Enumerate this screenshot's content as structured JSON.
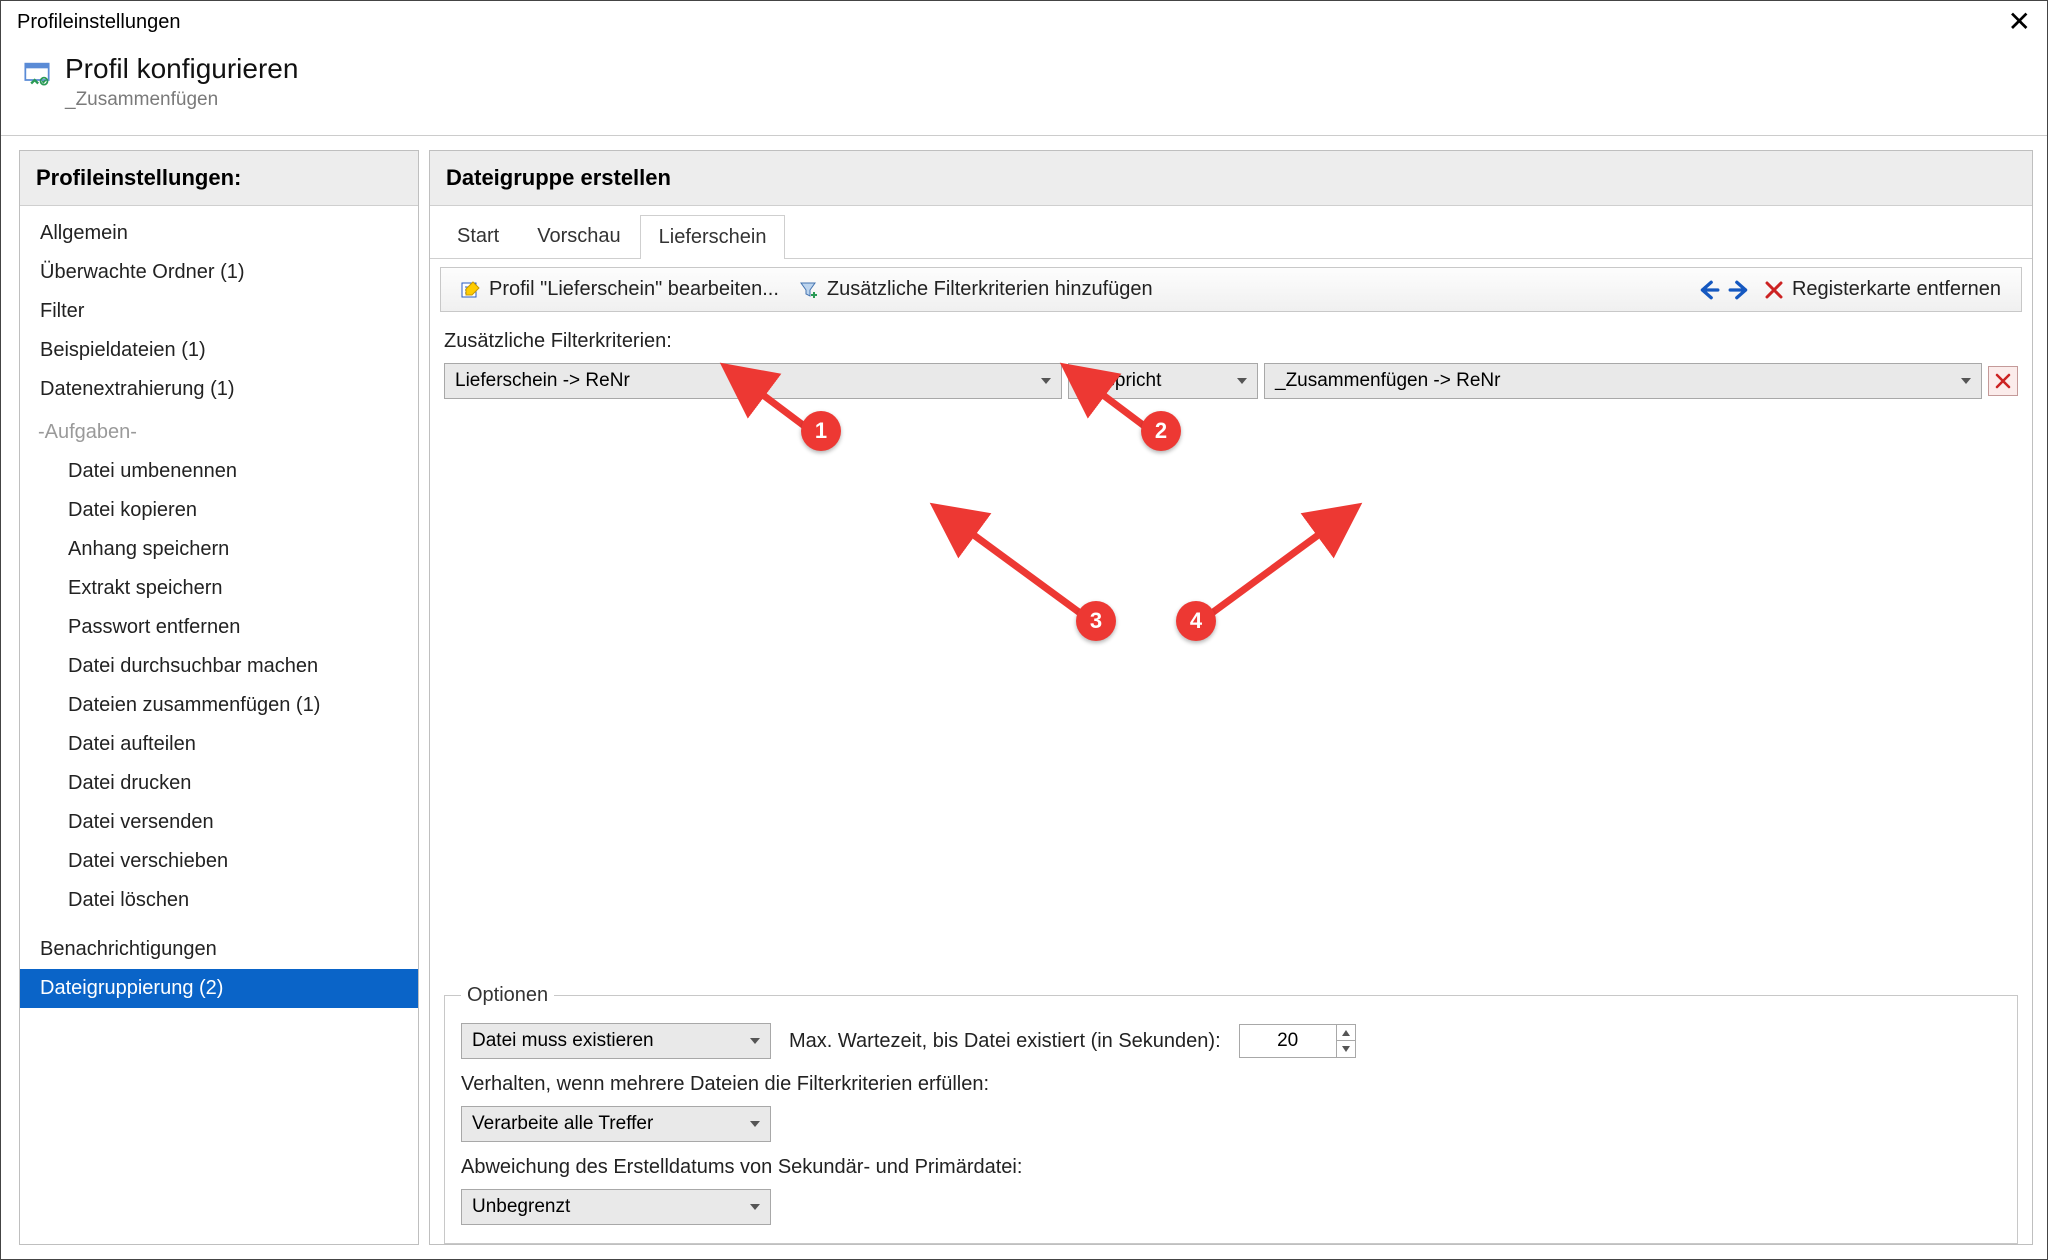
{
  "window": {
    "title": "Profileinstellungen"
  },
  "header": {
    "title": "Profil konfigurieren",
    "subtitle": "_Zusammenfügen"
  },
  "sidebar": {
    "title": "Profileinstellungen:",
    "items": [
      {
        "label": "Allgemein"
      },
      {
        "label": "Überwachte Ordner (1)"
      },
      {
        "label": "Filter"
      },
      {
        "label": "Beispieldateien (1)"
      },
      {
        "label": "Datenextrahierung (1)"
      }
    ],
    "tasks_header": "-Aufgaben-",
    "tasks": [
      {
        "label": "Datei umbenennen"
      },
      {
        "label": "Datei kopieren"
      },
      {
        "label": "Anhang speichern"
      },
      {
        "label": "Extrakt speichern"
      },
      {
        "label": "Passwort entfernen"
      },
      {
        "label": "Datei durchsuchbar machen"
      },
      {
        "label": "Dateien zusammenfügen (1)"
      },
      {
        "label": "Datei aufteilen"
      },
      {
        "label": "Datei drucken"
      },
      {
        "label": "Datei versenden"
      },
      {
        "label": "Datei verschieben"
      },
      {
        "label": "Datei löschen"
      }
    ],
    "footer": [
      {
        "label": "Benachrichtigungen"
      },
      {
        "label": "Dateigruppierung (2)",
        "selected": true
      }
    ]
  },
  "main": {
    "title": "Dateigruppe erstellen",
    "tabs": [
      {
        "label": "Start"
      },
      {
        "label": "Vorschau"
      },
      {
        "label": "Lieferschein",
        "active": true
      }
    ],
    "toolbar": {
      "edit_profile": "Profil \"Lieferschein\" bearbeiten...",
      "add_filter": "Zusätzliche Filterkriterien hinzufügen",
      "remove_tab": "Registerkarte entfernen"
    },
    "filter_section_label": "Zusätzliche Filterkriterien:",
    "filter_row": {
      "left": "Lieferschein -> ReNr",
      "op": "entspricht",
      "right": "_Zusammenfügen -> ReNr"
    },
    "options": {
      "legend": "Optionen",
      "exist_mode": "Datei muss existieren",
      "wait_label": "Max. Wartezeit, bis Datei existiert (in Sekunden):",
      "wait_value": "20",
      "multi_label": "Verhalten, wenn mehrere Dateien die Filterkriterien erfüllen:",
      "multi_value": "Verarbeite alle Treffer",
      "deviation_label": "Abweichung des Erstelldatums von Sekundär- und Primärdatei:",
      "deviation_value": "Unbegrenzt"
    }
  },
  "annotations": {
    "b1": "1",
    "b2": "2",
    "b3": "3",
    "b4": "4"
  }
}
